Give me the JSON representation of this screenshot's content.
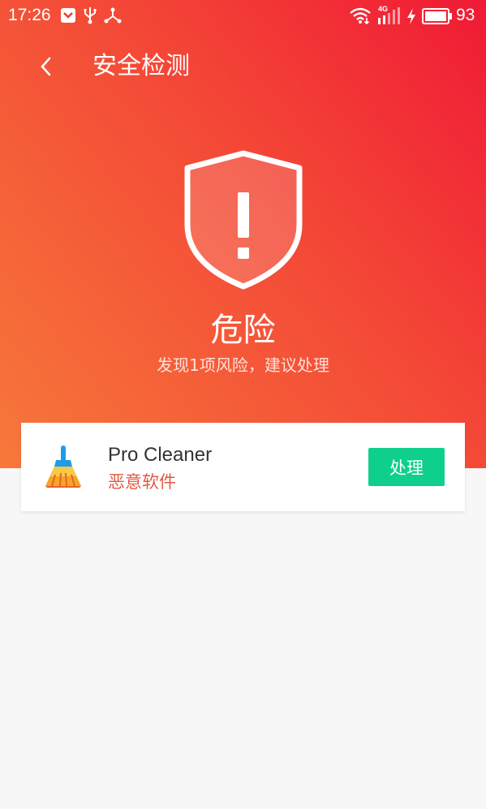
{
  "status_bar": {
    "time": "17:26",
    "network_label": "4G",
    "battery_percent": "93",
    "icons": [
      "notification-icon",
      "usb-icon",
      "share-icon",
      "wifi-icon",
      "signal-icon",
      "charging-icon",
      "battery-icon"
    ]
  },
  "app_bar": {
    "back_icon": "chevron-left-icon",
    "title": "安全检测"
  },
  "result": {
    "icon": "shield-alert-icon",
    "heading": "危险",
    "subtitle": "发现1项风险，建议处理"
  },
  "risks": [
    {
      "app_name": "Pro Cleaner",
      "tag": "恶意软件",
      "icon": "broom-icon",
      "action_label": "处理"
    }
  ],
  "colors": {
    "hero_top": "#f01a35",
    "hero_bottom": "#f7783a",
    "tag": "#e05a43",
    "action_button": "#0fcf8c",
    "background": "#f7f7f7"
  }
}
